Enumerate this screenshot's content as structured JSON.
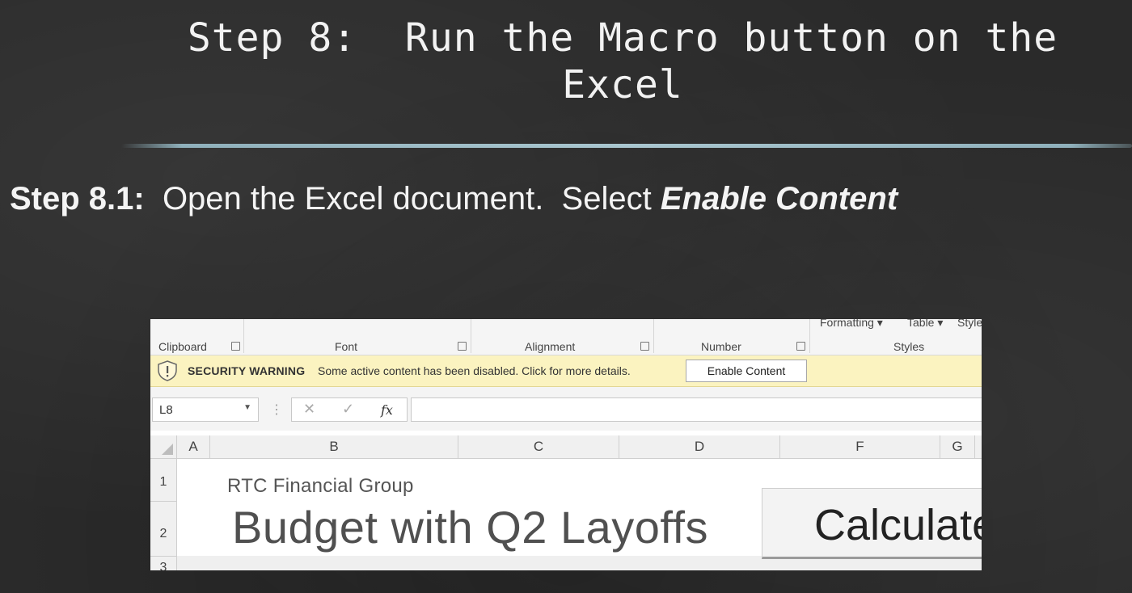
{
  "slide": {
    "title": "Step 8:  Run the Macro button on the Excel",
    "step_label": "Step 8.1:",
    "step_text": "  Open the Excel document.  Select ",
    "step_emphasis": "Enable Content"
  },
  "excel": {
    "ribbon": {
      "groups": [
        "Clipboard",
        "Font",
        "Alignment",
        "Number",
        "Styles"
      ],
      "top_buttons": [
        "Formatting ▾",
        "Table ▾",
        "Style"
      ]
    },
    "security_bar": {
      "title": "SECURITY WARNING",
      "message": "Some active content has been disabled. Click for more details.",
      "button_label": "Enable Content"
    },
    "formula_bar": {
      "name_box": "L8",
      "cancel_symbol": "✕",
      "enter_symbol": "✓",
      "fx_label": "fx",
      "formula": ""
    },
    "columns": [
      "A",
      "B",
      "C",
      "D",
      "F",
      "G"
    ],
    "rows": [
      "1",
      "2",
      "3"
    ],
    "cells": {
      "company": "RTC Financial Group",
      "title": "Budget with Q2 Layoffs"
    },
    "macro_button_label": "Calculate"
  },
  "colors": {
    "background": "#2a2a2a",
    "title_rule": "#a9c6cf",
    "security_bar": "#fbf3c0"
  }
}
